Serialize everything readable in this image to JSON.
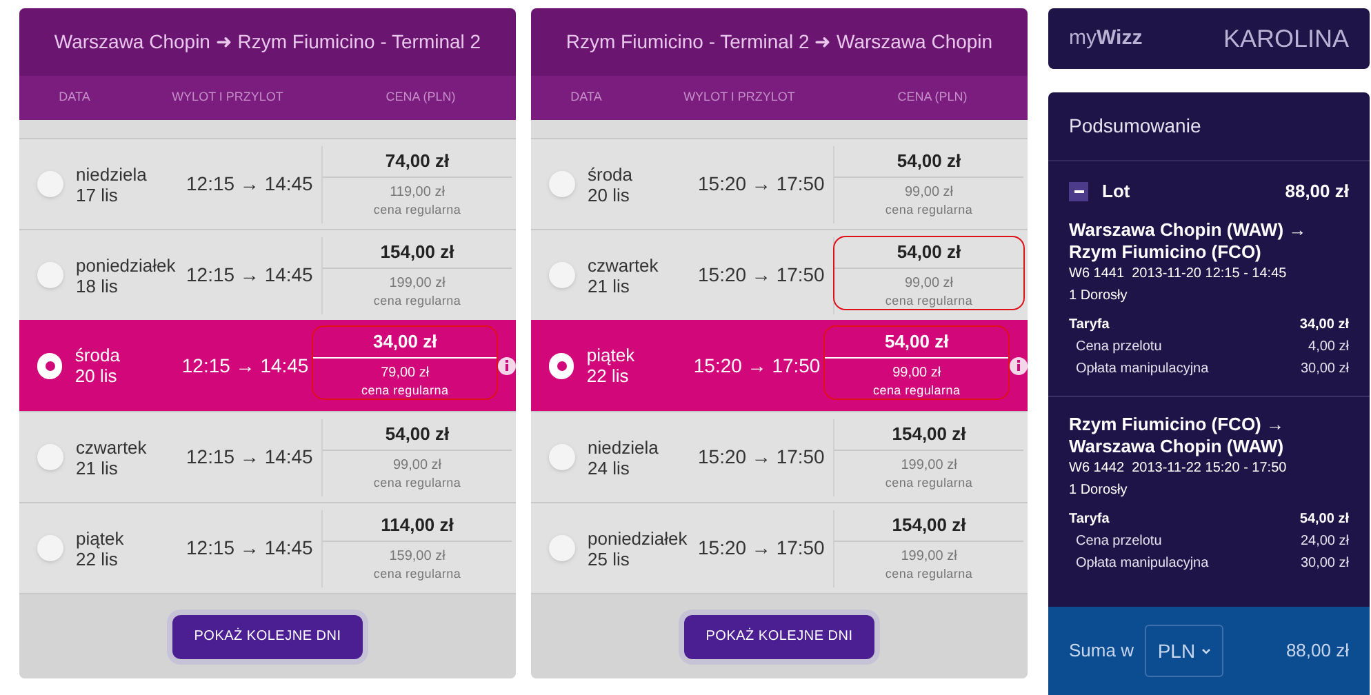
{
  "flights": [
    {
      "title": "Warszawa Chopin ➜ Rzym Fiumicino - Terminal 2",
      "columns": [
        "DATA",
        "WYLOT I PRZYLOT",
        "CENA (PLN)"
      ],
      "rows": [
        {
          "day": "niedziela",
          "date": "17 lis",
          "time": "12:15 → 14:45",
          "price": "74,00 zł",
          "regular_price": "119,00 zł",
          "regular_label": "cena regularna",
          "selected": false,
          "highlighted": false
        },
        {
          "day": "poniedziałek",
          "date": "18 lis",
          "time": "12:15 → 14:45",
          "price": "154,00 zł",
          "regular_price": "199,00 zł",
          "regular_label": "cena regularna",
          "selected": false,
          "highlighted": false
        },
        {
          "day": "środa",
          "date": "20 lis",
          "time": "12:15 → 14:45",
          "price": "34,00 zł",
          "regular_price": "79,00 zł",
          "regular_label": "cena regularna",
          "selected": true,
          "highlighted": true
        },
        {
          "day": "czwartek",
          "date": "21 lis",
          "time": "12:15 → 14:45",
          "price": "54,00 zł",
          "regular_price": "99,00 zł",
          "regular_label": "cena regularna",
          "selected": false,
          "highlighted": false
        },
        {
          "day": "piątek",
          "date": "22 lis",
          "time": "12:15 → 14:45",
          "price": "114,00 zł",
          "regular_price": "159,00 zł",
          "regular_label": "cena regularna",
          "selected": false,
          "highlighted": false
        }
      ],
      "button": "POKAŻ KOLEJNE DNI"
    },
    {
      "title": "Rzym Fiumicino - Terminal 2 ➜ Warszawa Chopin",
      "columns": [
        "DATA",
        "WYLOT I PRZYLOT",
        "CENA (PLN)"
      ],
      "rows": [
        {
          "day": "środa",
          "date": "20 lis",
          "time": "15:20 → 17:50",
          "price": "54,00 zł",
          "regular_price": "99,00 zł",
          "regular_label": "cena regularna",
          "selected": false,
          "highlighted": false
        },
        {
          "day": "czwartek",
          "date": "21 lis",
          "time": "15:20 → 17:50",
          "price": "54,00 zł",
          "regular_price": "99,00 zł",
          "regular_label": "cena regularna",
          "selected": false,
          "highlighted": true
        },
        {
          "day": "piątek",
          "date": "22 lis",
          "time": "15:20 → 17:50",
          "price": "54,00 zł",
          "regular_price": "99,00 zł",
          "regular_label": "cena regularna",
          "selected": true,
          "highlighted": true
        },
        {
          "day": "niedziela",
          "date": "24 lis",
          "time": "15:20 → 17:50",
          "price": "154,00 zł",
          "regular_price": "199,00 zł",
          "regular_label": "cena regularna",
          "selected": false,
          "highlighted": false
        },
        {
          "day": "poniedziałek",
          "date": "25 lis",
          "time": "15:20 → 17:50",
          "price": "154,00 zł",
          "regular_price": "199,00 zł",
          "regular_label": "cena regularna",
          "selected": false,
          "highlighted": false
        }
      ],
      "button": "POKAŻ KOLEJNE DNI"
    }
  ],
  "account": {
    "brand": "my**Wizz**",
    "user": "KAROLINA"
  },
  "summary": {
    "title": "Podsumowanie",
    "section": {
      "label": "Lot",
      "total": "88,00 zł",
      "expanded": true
    },
    "legs": [
      {
        "route": "Warszawa Chopin (WAW) → Rzym Fiumicino (FCO)",
        "details": "W6 1441  2013-11-20 12:15 - 14:45",
        "passengers": "1 Dorosły",
        "fare_label": "Taryfa",
        "fare": "34,00 zł",
        "items": [
          {
            "label": "Cena przelotu",
            "value": "4,00 zł"
          },
          {
            "label": "Opłata manipulacyjna",
            "value": "30,00 zł"
          }
        ]
      },
      {
        "route": "Rzym Fiumicino (FCO) → Warszawa Chopin (WAW)",
        "details": "W6 1442  2013-11-22 15:20 - 17:50",
        "passengers": "1 Dorosły",
        "fare_label": "Taryfa",
        "fare": "54,00 zł",
        "items": [
          {
            "label": "Cena przelotu",
            "value": "24,00 zł"
          },
          {
            "label": "Opłata manipulacyjna",
            "value": "30,00 zł"
          }
        ]
      }
    ],
    "total_label": "Suma w",
    "currency": "PLN",
    "total": "88,00 zł"
  }
}
